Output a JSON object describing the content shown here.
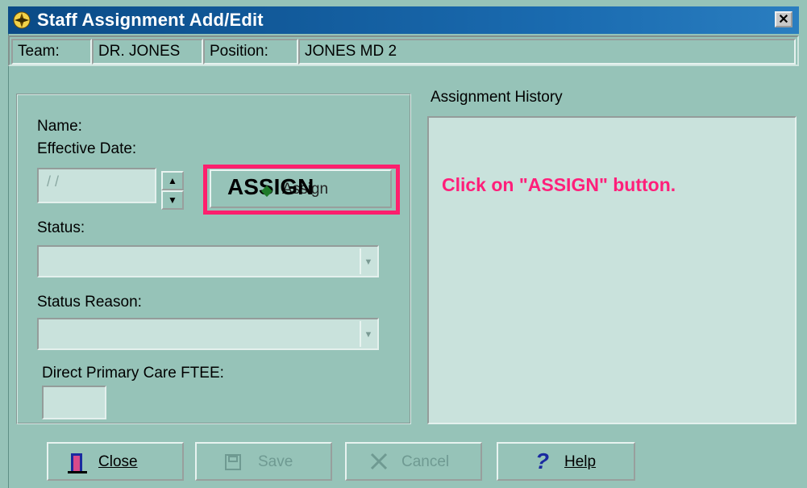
{
  "window": {
    "title": "Staff Assignment Add/Edit",
    "close_glyph": "✕"
  },
  "infobar": {
    "team_label": "Team:",
    "team_value": "DR. JONES",
    "position_label": "Position:",
    "position_value": "JONES MD 2"
  },
  "form": {
    "name_label": "Name:",
    "effective_date_label": "Effective Date:",
    "effective_date_value": "/ /",
    "assign_button_label": "Assign",
    "assign_overlay_text": "ASSIGN",
    "status_label": "Status:",
    "status_reason_label": "Status Reason:",
    "ftee_label": "Direct Primary Care FTEE:"
  },
  "history": {
    "label": "Assignment History",
    "instruction": "Click on \"ASSIGN\" button."
  },
  "buttons": {
    "close": "Close",
    "save": "Save",
    "cancel": "Cancel",
    "help": "Help"
  },
  "colors": {
    "highlight": "#ff1f6d",
    "instruction": "#ff1f7a",
    "titlebar": "#0a4a86"
  }
}
